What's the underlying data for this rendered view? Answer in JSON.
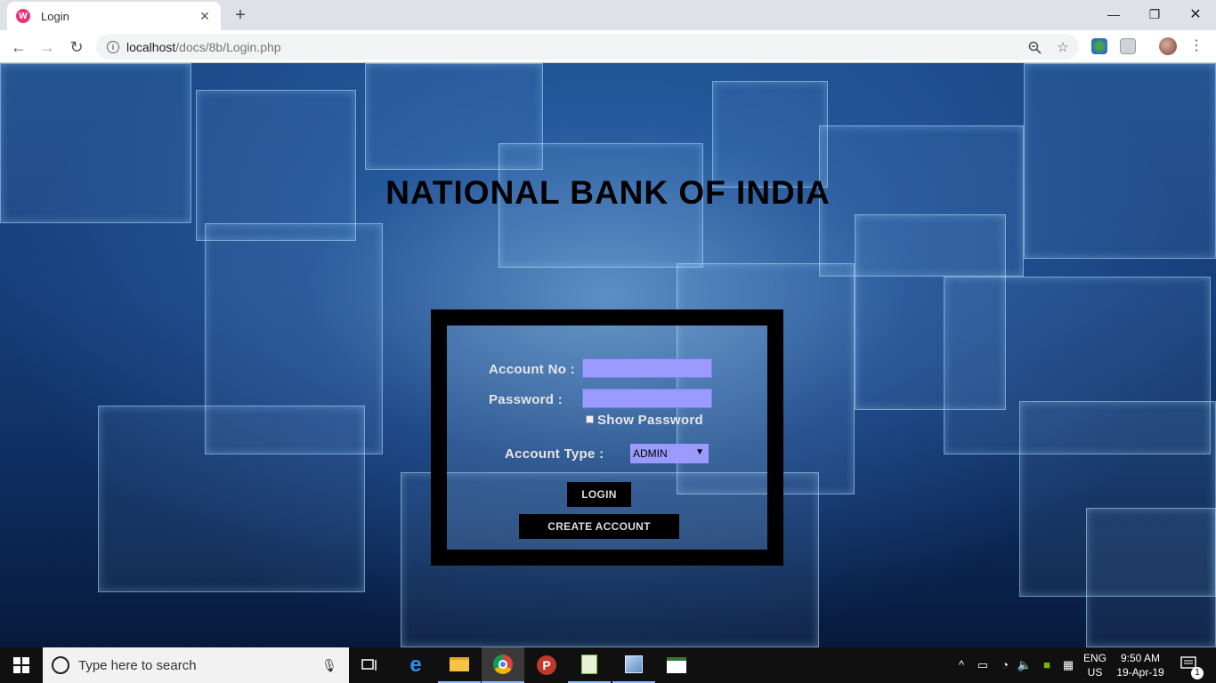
{
  "browser": {
    "tab_title": "Login",
    "favicon_letter": "W",
    "url_host": "localhost",
    "url_path": "/docs/8b/Login.php"
  },
  "page": {
    "title": "NATIONAL BANK OF INDIA",
    "form": {
      "account_no_label": "Account No :",
      "password_label": "Password :",
      "show_password_label": "Show Password",
      "account_type_label": "Account Type :",
      "account_type_value": "ADMIN",
      "login_button": "LOGIN",
      "create_account_button": "CREATE ACCOUNT"
    }
  },
  "taskbar": {
    "search_placeholder": "Type here to search",
    "lang_top": "ENG",
    "lang_bottom": "US",
    "time": "9:50 AM",
    "date": "19-Apr-19",
    "notification_count": "1"
  },
  "colors": {
    "field_bg": "#9b9bff",
    "frame": "#000000",
    "title": "#000000",
    "tab_favicon": "#e5337f"
  }
}
